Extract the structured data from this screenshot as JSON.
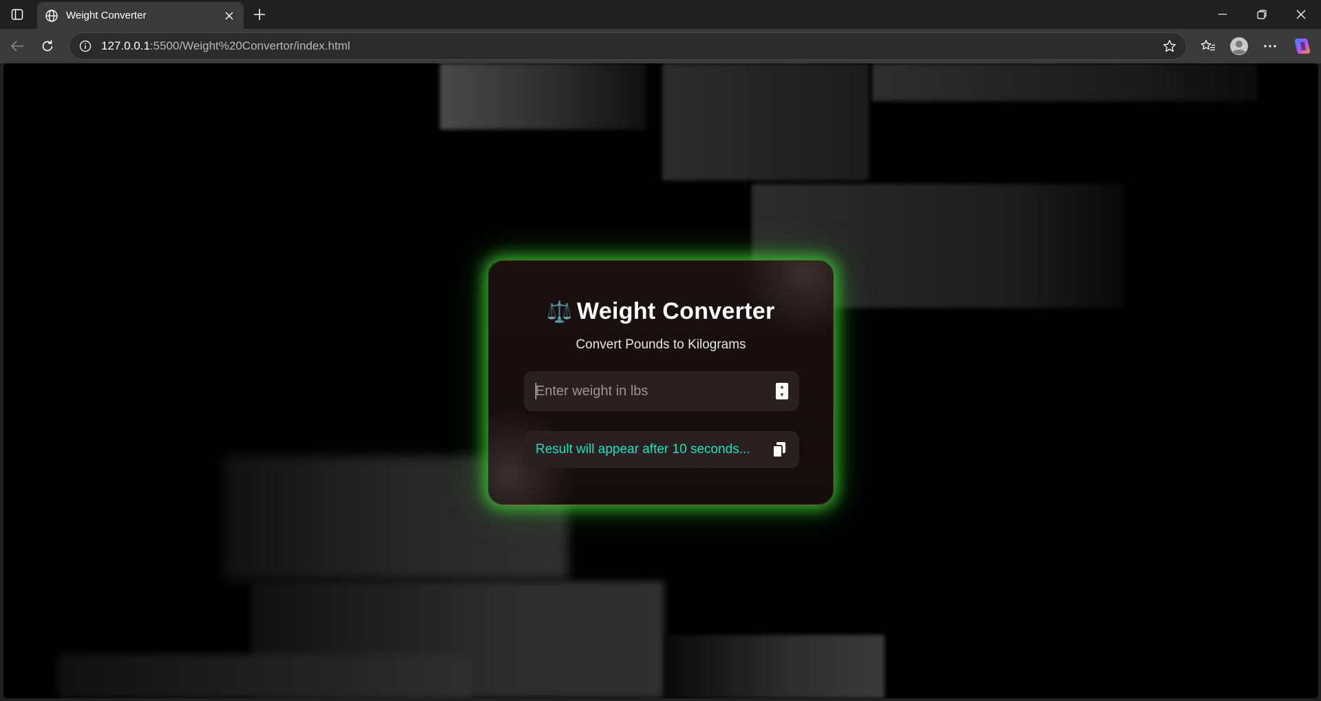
{
  "browser": {
    "tab_title": "Weight Converter",
    "url_host": "127.0.0.1",
    "url_rest": ":5500/Weight%20Convertor/index.html",
    "icons": [
      "tab-actions-icon",
      "globe-icon",
      "close-icon",
      "plus-icon",
      "minimize-icon",
      "restore-icon",
      "close-window-icon",
      "back-icon",
      "reload-icon",
      "info-icon",
      "star-icon",
      "favorites-icon",
      "profile-icon",
      "more-icon",
      "copilot-icon"
    ]
  },
  "card": {
    "emoji": "⚖️",
    "title": "Weight Converter",
    "subtitle": "Convert Pounds to Kilograms",
    "input_placeholder": "Enter weight in lbs",
    "input_value": "",
    "result_text": "Result will appear after 10 seconds...",
    "glow_color": "#42dc38",
    "result_color": "#1de2c0"
  }
}
